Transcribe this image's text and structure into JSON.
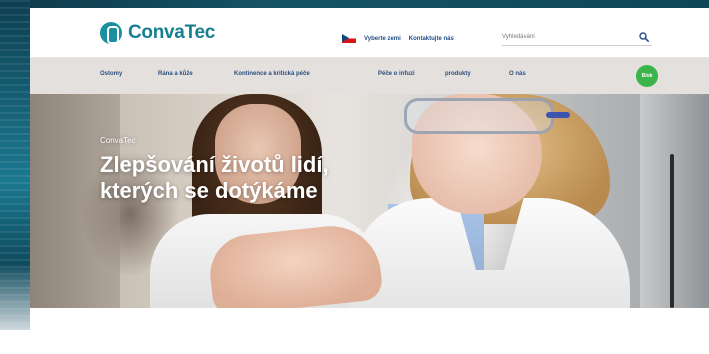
{
  "header": {
    "brand": "ConvaTec",
    "language_label": "Vyberte zemi",
    "contact_label": "Kontaktujte nás",
    "search_placeholder": "Vyhledávání"
  },
  "nav": {
    "items": [
      {
        "label": "Ostomy"
      },
      {
        "label": "Rána a kůže"
      },
      {
        "label": "Kontinence a kritická péče"
      },
      {
        "label": "Péče o infuzi"
      },
      {
        "label": "produkty"
      },
      {
        "label": "O nás"
      }
    ],
    "badge": "Blok"
  },
  "hero": {
    "kicker": "ConvaTec",
    "title": "Zlepšování životů lidí, kterých se dotýkáme"
  },
  "colors": {
    "brand": "#167f90",
    "nav_text": "#2a4f7f",
    "badge": "#3bb54a"
  },
  "icons": {
    "logo": "convatec-logo-icon",
    "flag": "czech-flag-icon",
    "search": "search-icon"
  }
}
